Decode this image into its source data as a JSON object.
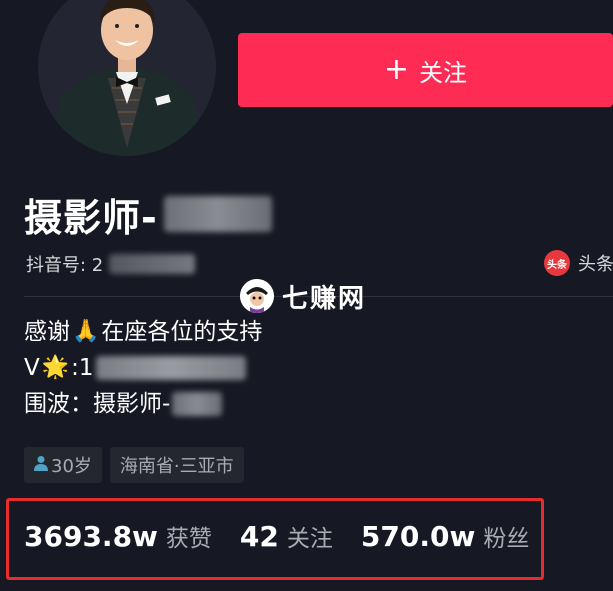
{
  "profile": {
    "name": "摄影师-",
    "douyin_id_label": "抖音号: 2",
    "toutiao_label": "头条",
    "toutiao_icon_text": "头条",
    "follow_button": "关注",
    "follow_icon": "plus-icon"
  },
  "watermark": {
    "text": "七赚网"
  },
  "bio": {
    "line1_before": "感谢",
    "line1_emoji": "🙏",
    "line1_after": "在座各位的支持",
    "line2_prefix": "V",
    "line2_emoji": "🌟",
    "line2_suffix": ":1",
    "line3": "围波：摄影师-"
  },
  "tags": {
    "age": "30岁",
    "location": "海南省·三亚市"
  },
  "stats": {
    "likes_value": "3693.8w",
    "likes_label": "获赞",
    "following_value": "42",
    "following_label": "关注",
    "followers_value": "570.0w",
    "followers_label": "粉丝"
  },
  "colors": {
    "background": "#161823",
    "accent": "#fe2c55",
    "highlight_box": "#e62c2c"
  }
}
